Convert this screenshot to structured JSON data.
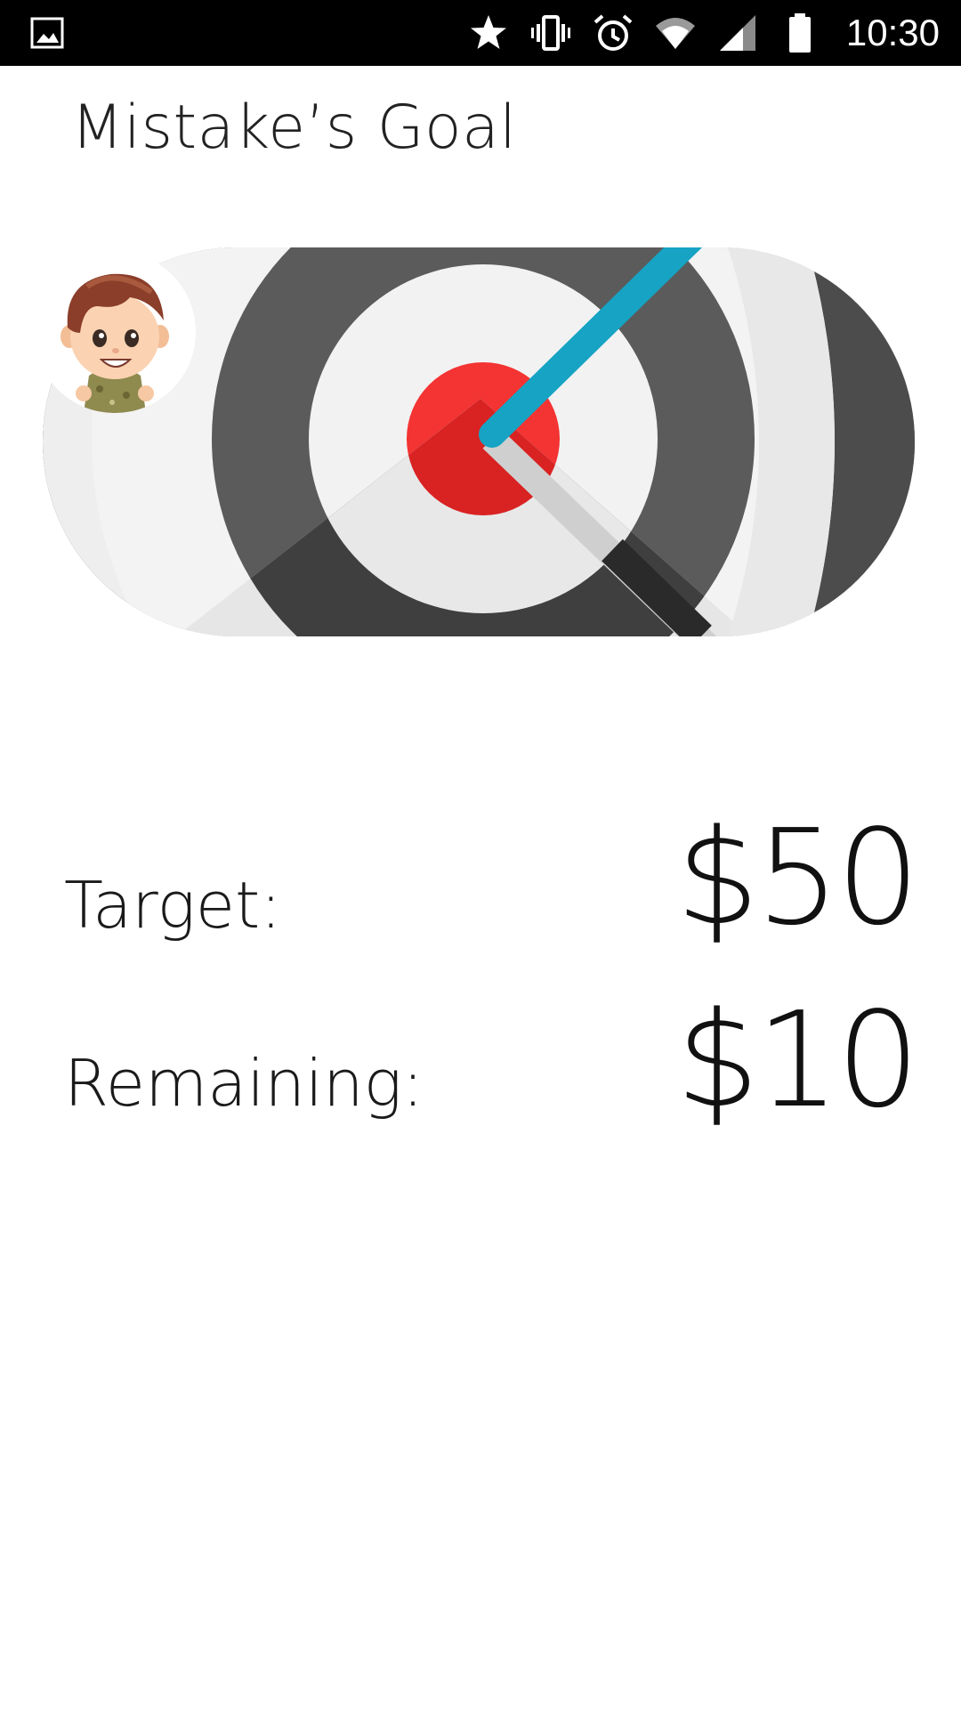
{
  "status_bar": {
    "left_icon": "image-notification-icon",
    "icons": [
      "star-icon",
      "vibrate-icon",
      "alarm-icon",
      "wifi-icon",
      "cell-signal-icon",
      "battery-icon"
    ],
    "time": "10:30"
  },
  "page": {
    "title": "Mistake’s Goal"
  },
  "hero": {
    "image": "target-dartboard-image",
    "avatar": "cartoon-boy-avatar",
    "colors": {
      "bullseye": "#f43333",
      "dart": "#16a3c4",
      "ring_dark": "#5a5a5a",
      "ring_light": "#f1f1f1"
    }
  },
  "goal": {
    "target_label": "Target:",
    "target_value": "$50",
    "remaining_label": "Remaining:",
    "remaining_value": "$10"
  }
}
